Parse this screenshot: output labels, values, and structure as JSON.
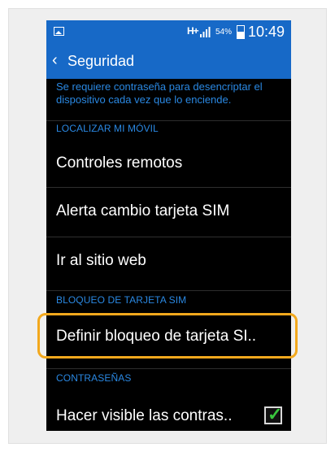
{
  "status_bar": {
    "network": "H+",
    "battery_percent": "54%",
    "time": "10:49",
    "icons": {
      "gallery": "image-icon",
      "signal": "signal-icon",
      "battery": "battery-icon"
    }
  },
  "action_bar": {
    "back_icon": "‹",
    "title": "Seguridad"
  },
  "description": "Se requiere contraseña para desencriptar el dispositivo cada vez que lo enciende.",
  "sections": {
    "localizar": "LOCALIZAR MI MÓVIL",
    "bloqueo_sim": "BLOQUEO DE TARJETA SIM",
    "contrasenas": "CONTRASEÑAS"
  },
  "items": [
    "Controles remotos",
    "Alerta cambio tarjeta SIM",
    "Ir al sitio web",
    "Definir bloqueo de tarjeta SI..",
    "Hacer visible las contras.."
  ],
  "checkbox": {
    "checked": true,
    "icon": "check-icon"
  },
  "colors": {
    "accent_blue": "#1769c7",
    "section_blue": "#2a88e2",
    "highlight_orange": "#f2a81d",
    "check_green": "#39c63d"
  }
}
